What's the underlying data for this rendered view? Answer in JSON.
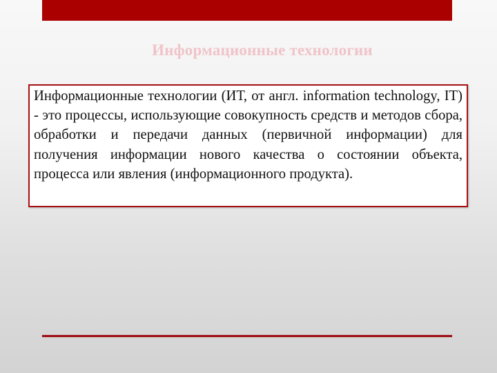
{
  "slide": {
    "title": "Информационные технологии",
    "definition": "Информационные технологии (ИТ, от англ. information technology, IT)  - это процессы, использующие совокупность средств и методов сбора, обработки и передачи данных (первичной информации) для получения информации нового качества о состоянии объекта, процесса или явления (информационного продукта).",
    "colors": {
      "accent": "#ab0000",
      "title": "#f0c4c8",
      "box_border": "#a80f14"
    }
  }
}
